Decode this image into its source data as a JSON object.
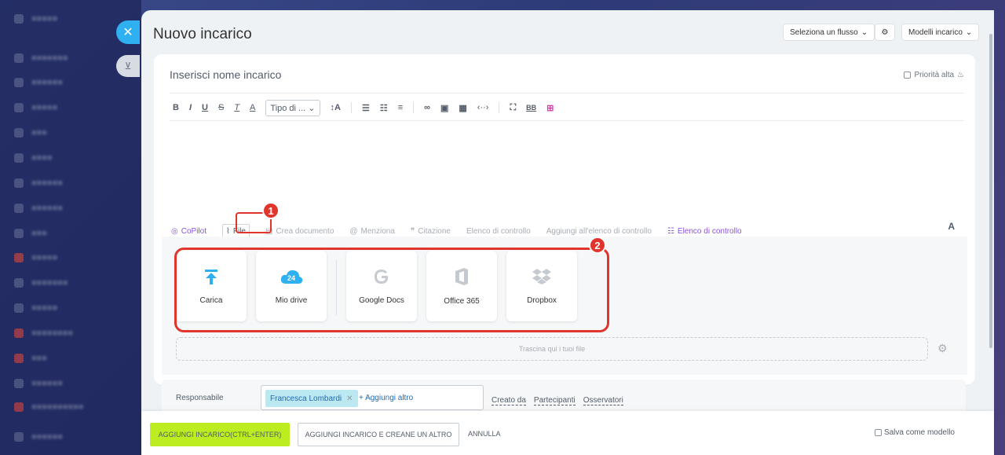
{
  "window": {
    "title": "Nuovo incarico"
  },
  "header": {
    "flow_select": "Seleziona un flusso",
    "templates": "Modelli incarico"
  },
  "form": {
    "task_name_placeholder": "Inserisci nome incarico",
    "priority_label": "Priorità alta"
  },
  "toolbar": {
    "font_type": "Tipo di ...",
    "bold": "B",
    "italic": "I",
    "underline": "U",
    "strike": "S",
    "clear": "T",
    "color": "A",
    "size": "↕A",
    "bbcode": "BB"
  },
  "actions": {
    "copilot": "CoPilot",
    "file": "File",
    "create_doc": "Crea documento",
    "mention": "Menziona",
    "quote": "Citazione",
    "checklist": "Elenco di controllo",
    "add_checklist": "Aggiungi all'elenco di controllo",
    "checklist2": "Elenco di controllo",
    "font": "A"
  },
  "annotations": {
    "badge1": "1",
    "badge2": "2"
  },
  "services": [
    {
      "label": "Carica",
      "icon": "upload-icon"
    },
    {
      "label": "Mio drive",
      "icon": "cloud-drive-icon",
      "badge": "24"
    },
    {
      "label": "Google Docs",
      "icon": "google-icon"
    },
    {
      "label": "Office 365",
      "icon": "office-icon"
    },
    {
      "label": "Dropbox",
      "icon": "dropbox-icon"
    }
  ],
  "dropzone": "Trascina qui i tuoi file",
  "responsible": {
    "label": "Responsabile",
    "person": "Francesca Lombardi",
    "add_more": "+ Aggiungi altro",
    "created_by": "Creato da",
    "participants": "Partecipanti",
    "observers": "Osservatori"
  },
  "footer": {
    "primary": "AGGIUNGI INCARICO(CTRL+ENTER)",
    "secondary": "AGGIUNGI INCARICO E CREANE UN ALTRO",
    "cancel": "ANNULLA",
    "save_template": "Salva come modello"
  },
  "colors": {
    "accent": "#2fb0f0",
    "primary_button": "#bbed21",
    "highlight": "#e0342c",
    "chip": "#bce8f1"
  }
}
